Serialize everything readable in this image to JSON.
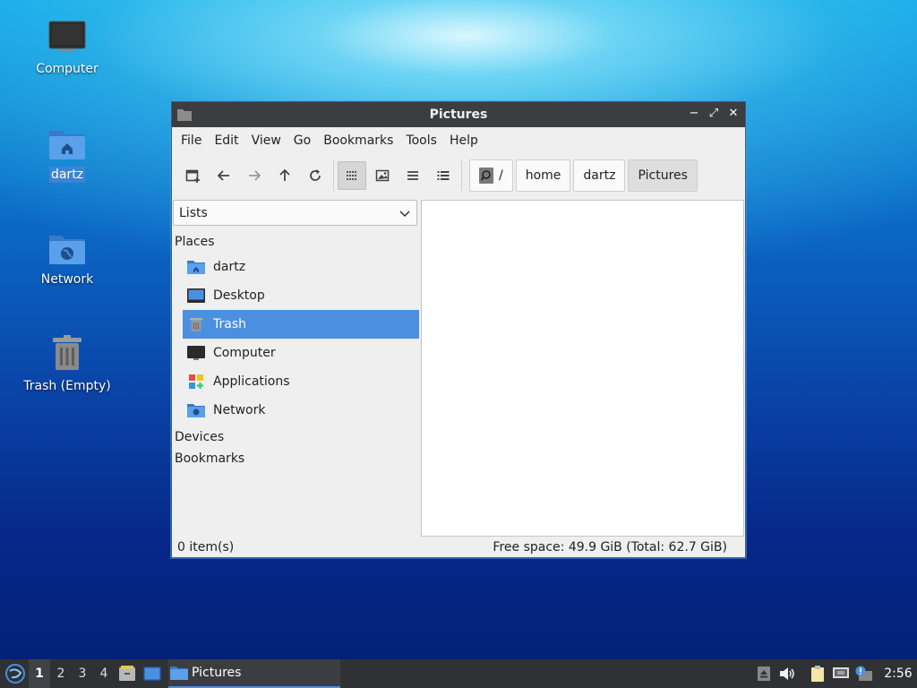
{
  "desktop": {
    "icons": [
      {
        "label": "Computer",
        "icon": "monitor-icon"
      },
      {
        "label": "dartz",
        "icon": "home-folder-icon"
      },
      {
        "label": "Network",
        "icon": "network-folder-icon"
      },
      {
        "label": "Trash (Empty)",
        "icon": "trash-icon"
      }
    ]
  },
  "window": {
    "title": "Pictures",
    "controls": {
      "minimize": "−",
      "maximize": "⤢",
      "close": "✕"
    },
    "menu": [
      "File",
      "Edit",
      "View",
      "Go",
      "Bookmarks",
      "Tools",
      "Help"
    ],
    "toolbar": {
      "buttons": [
        "new-tab-icon",
        "back-arrow-icon",
        "forward-arrow-icon",
        "up-arrow-icon",
        "reload-icon",
        "icon-view-icon",
        "thumbnail-view-icon",
        "compact-view-icon",
        "detailed-list-icon"
      ],
      "active_view": "icon-view-icon"
    },
    "breadcrumb": {
      "root": "/",
      "items": [
        "home",
        "dartz",
        "Pictures"
      ]
    },
    "sidebar": {
      "mode": "Lists",
      "places_header": "Places",
      "places": [
        {
          "label": "dartz",
          "icon": "home-folder-icon"
        },
        {
          "label": "Desktop",
          "icon": "desktop-icon"
        },
        {
          "label": "Trash",
          "icon": "trash-icon"
        },
        {
          "label": "Computer",
          "icon": "monitor-icon"
        },
        {
          "label": "Applications",
          "icon": "applications-icon"
        },
        {
          "label": "Network",
          "icon": "network-folder-icon"
        }
      ],
      "selected": "Trash",
      "devices_header": "Devices",
      "bookmarks_header": "Bookmarks"
    },
    "status": {
      "items": "0 item(s)",
      "free_space": "Free space: 49.9 GiB (Total: 62.7 GiB)"
    }
  },
  "taskbar": {
    "workspaces": [
      "1",
      "2",
      "3",
      "4"
    ],
    "active_workspace": "1",
    "task_label": "Pictures",
    "clock": "2:56"
  },
  "colors": {
    "accent": "#4b8fe0",
    "titlebar": "#3b3d40",
    "taskbar": "#2f3134",
    "folder": "#5294e2"
  }
}
